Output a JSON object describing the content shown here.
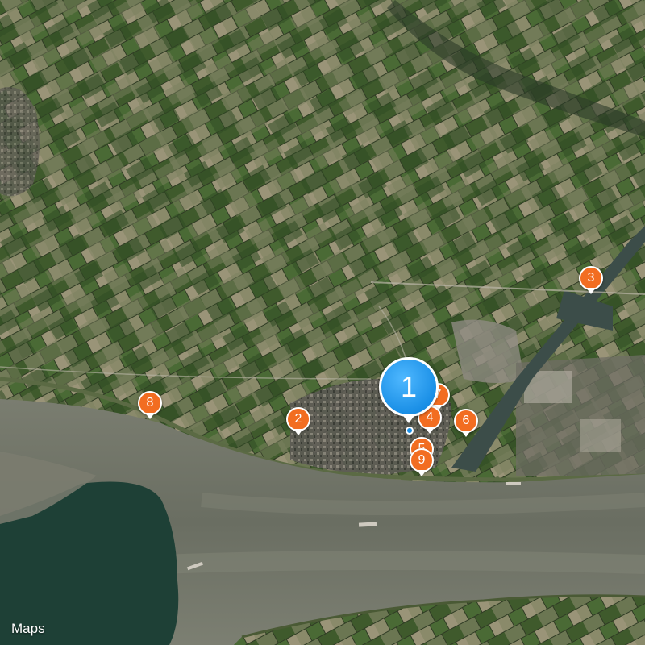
{
  "map": {
    "type": "satellite",
    "attribution": {
      "logo_glyph": "",
      "label": "Maps"
    },
    "selected_marker": "1",
    "markers": [
      {
        "label": "1",
        "kind": "selected",
        "color": "#1d9bf0"
      },
      {
        "label": "2",
        "kind": "poi",
        "color": "#f26d21"
      },
      {
        "label": "3",
        "kind": "poi",
        "color": "#f26d21"
      },
      {
        "label": "4",
        "kind": "poi",
        "color": "#f26d21"
      },
      {
        "label": "5",
        "kind": "poi",
        "color": "#f26d21"
      },
      {
        "label": "6",
        "kind": "poi",
        "color": "#f26d21"
      },
      {
        "label": "7",
        "kind": "poi",
        "color": "#f26d21"
      },
      {
        "label": "8",
        "kind": "poi",
        "color": "#f26d21"
      },
      {
        "label": "9",
        "kind": "poi",
        "color": "#f26d21"
      }
    ],
    "colors": {
      "marker": "#f26d21",
      "selected": "#1d9bf0",
      "water": "#6f7466",
      "deep_water": "#1e4036"
    }
  }
}
